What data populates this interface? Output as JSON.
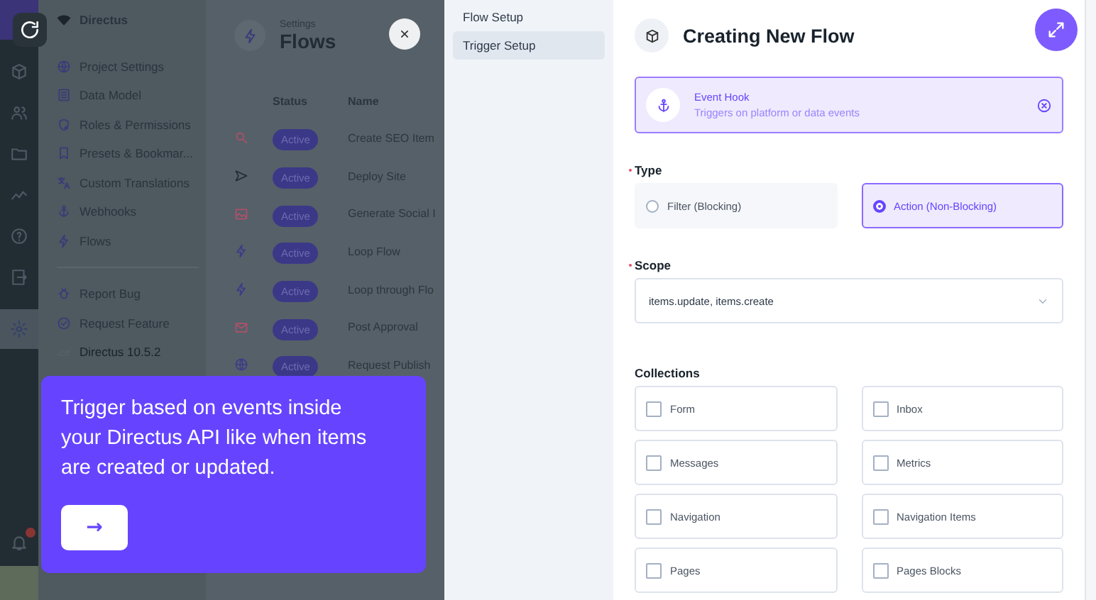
{
  "background_app": {
    "project": {
      "name": "Directus"
    },
    "settings_nav": [
      {
        "label": "Project Settings"
      },
      {
        "label": "Data Model"
      },
      {
        "label": "Roles & Permissions"
      },
      {
        "label": "Presets & Bookmar..."
      },
      {
        "label": "Custom Translations"
      },
      {
        "label": "Webhooks"
      },
      {
        "label": "Flows"
      }
    ],
    "support_nav": [
      {
        "label": "Report Bug"
      },
      {
        "label": "Request Feature"
      }
    ],
    "version": "Directus 10.5.2",
    "header": {
      "breadcrumb": "Settings",
      "title": "Flows"
    },
    "table": {
      "columns": [
        "Status",
        "Name"
      ],
      "rows": [
        {
          "color": "#b0506a",
          "status": "Active",
          "name": "Create SEO Item"
        },
        {
          "color": "#1f2a33",
          "status": "Active",
          "name": "Deploy Site"
        },
        {
          "color": "#b0506a",
          "status": "Active",
          "name": "Generate Social I"
        },
        {
          "color": "#3d3a8a",
          "status": "Active",
          "name": "Loop Flow"
        },
        {
          "color": "#3d3a8a",
          "status": "Active",
          "name": "Loop through Flo"
        },
        {
          "color": "#b0506a",
          "status": "Active",
          "name": "Post Approval"
        },
        {
          "color": "#3d3a8a",
          "status": "Active",
          "name": "Request Publish"
        }
      ]
    },
    "notifications": {
      "unread": true
    }
  },
  "tour_tip": {
    "text": "Trigger based on events inside your Directus API like when items are created or updated.",
    "next_button": "→"
  },
  "drawer": {
    "steps": [
      {
        "label": "Flow Setup",
        "selected": false
      },
      {
        "label": "Trigger Setup",
        "selected": true
      }
    ],
    "title": "Creating New Flow",
    "trigger": {
      "name": "Event Hook",
      "description": "Triggers on platform or data events"
    },
    "type": {
      "label": "Type",
      "required": true,
      "options": [
        {
          "label": "Filter (Blocking)",
          "selected": false
        },
        {
          "label": "Action (Non-Blocking)",
          "selected": true
        }
      ]
    },
    "scope": {
      "label": "Scope",
      "required": true,
      "value": "items.update, items.create"
    },
    "collections": {
      "label": "Collections",
      "items": [
        {
          "label": "Form",
          "checked": false
        },
        {
          "label": "Inbox",
          "checked": false
        },
        {
          "label": "Messages",
          "checked": false
        },
        {
          "label": "Metrics",
          "checked": false
        },
        {
          "label": "Navigation",
          "checked": false
        },
        {
          "label": "Navigation Items",
          "checked": false
        },
        {
          "label": "Pages",
          "checked": false
        },
        {
          "label": "Pages Blocks",
          "checked": false
        }
      ]
    }
  }
}
